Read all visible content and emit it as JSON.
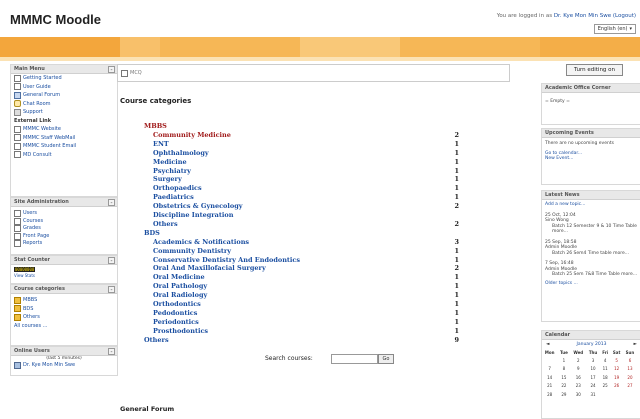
{
  "header": {
    "site_title": "MMMC Moodle",
    "login_prefix": "You are logged in as",
    "login_user": "Dr. Kye Mon Min Swe",
    "login_suffix": "(Logout)",
    "language": "English (en)"
  },
  "brand_colors": {
    "band": "#f6b756",
    "band_light": "#fbe2b4",
    "link": "#1a4ea0",
    "category_red": "#a01a1a"
  },
  "main_menu": {
    "title": "Main Menu",
    "items": [
      {
        "label": "Getting Started",
        "icon": "doc-icon"
      },
      {
        "label": "User Guide",
        "icon": "doc-icon"
      },
      {
        "label": "General Forum",
        "icon": "forum-icon"
      },
      {
        "label": "Chat Room",
        "icon": "chat-icon"
      },
      {
        "label": "Support",
        "icon": "lock-icon"
      }
    ],
    "external_title": "External Link",
    "external": [
      {
        "label": "MMMC Website"
      },
      {
        "label": "MMMC Staff WebMail"
      },
      {
        "label": "MMMC Student Email"
      },
      {
        "label": "MD Consult"
      }
    ]
  },
  "site_admin": {
    "title": "Site Administration",
    "items": [
      "Users",
      "Courses",
      "Grades",
      "Front Page",
      "Reports"
    ]
  },
  "stat_counter": {
    "title": "Stat Counter",
    "counter": "00000000",
    "caption": "View Stats"
  },
  "course_categories_block": {
    "title": "Course categories",
    "items": [
      "MBBS",
      "BDS",
      "Others"
    ],
    "all_courses": "All courses ..."
  },
  "online_users": {
    "title": "Online Users",
    "note": "(last 5 minutes)",
    "user": "Dr. Kye Mon Min Swe"
  },
  "main": {
    "mcq": "MCQ",
    "heading": "Course categories",
    "search_label": "Search courses:",
    "go_label": "Go",
    "general_forum": "General Forum"
  },
  "categories": [
    {
      "name": "MBBS",
      "count": "",
      "level": 0,
      "red": true
    },
    {
      "name": "Community Medicine",
      "count": "2",
      "level": 1,
      "red": true
    },
    {
      "name": "ENT",
      "count": "1",
      "level": 1
    },
    {
      "name": "Ophthalmology",
      "count": "1",
      "level": 1
    },
    {
      "name": "Medicine",
      "count": "1",
      "level": 1
    },
    {
      "name": "Psychiatry",
      "count": "1",
      "level": 1
    },
    {
      "name": "Surgery",
      "count": "1",
      "level": 1
    },
    {
      "name": "Orthopaedics",
      "count": "1",
      "level": 1
    },
    {
      "name": "Paediatrics",
      "count": "1",
      "level": 1
    },
    {
      "name": "Obstetrics & Gynecology",
      "count": "2",
      "level": 1
    },
    {
      "name": "Discipline Integration",
      "count": "",
      "level": 1
    },
    {
      "name": "Others",
      "count": "2",
      "level": 1
    },
    {
      "name": "BDS",
      "count": "",
      "level": 0
    },
    {
      "name": "Academics & Notifications",
      "count": "3",
      "level": 1
    },
    {
      "name": "Community Dentistry",
      "count": "1",
      "level": 1
    },
    {
      "name": "Conservative Dentistry And Endodontics",
      "count": "1",
      "level": 1
    },
    {
      "name": "Oral And Maxillofacial Surgery",
      "count": "2",
      "level": 1
    },
    {
      "name": "Oral Medicine",
      "count": "1",
      "level": 1
    },
    {
      "name": "Oral Pathology",
      "count": "1",
      "level": 1
    },
    {
      "name": "Oral Radiology",
      "count": "1",
      "level": 1
    },
    {
      "name": "Orthodontics",
      "count": "1",
      "level": 1
    },
    {
      "name": "Pedodontics",
      "count": "1",
      "level": 1
    },
    {
      "name": "Periodontics",
      "count": "1",
      "level": 1
    },
    {
      "name": "Prosthodontics",
      "count": "1",
      "level": 1
    },
    {
      "name": "Others",
      "count": "9",
      "level": 0
    }
  ],
  "right": {
    "turn_editing": "Turn editing on",
    "academic": {
      "title": "Academic Office Corner",
      "body": "= Empty ="
    },
    "upcoming": {
      "title": "Upcoming Events",
      "body": "There are no upcoming events",
      "link1": "Go to calendar...",
      "link2": "New Event..."
    },
    "news": {
      "title": "Latest News",
      "add": "Add a new topic...",
      "posts": [
        {
          "date": "25 Oct, 12:04",
          "author": "Sino Wong",
          "text": "Batch 12 Semester 9 & 10 Time Table more..."
        },
        {
          "date": "25 Sep, 18:58",
          "author": "Admin Moodle",
          "text": "Batch 26 Sem4 Time table more..."
        },
        {
          "date": "7 Sep, 16:48",
          "author": "Admin Moodle",
          "text": "Batch 25 Sem 7&8 Time Table more..."
        }
      ],
      "older": "Older topics ..."
    },
    "calendar": {
      "title": "Calendar",
      "month": "January 2013",
      "days": [
        "Mon",
        "Tue",
        "Wed",
        "Thu",
        "Fri",
        "Sat",
        "Sun"
      ],
      "weeks": [
        [
          "",
          "1",
          "2",
          "3",
          "4",
          "5",
          "6"
        ],
        [
          "7",
          "8",
          "9",
          "10",
          "11",
          "12",
          "13"
        ],
        [
          "14",
          "15",
          "16",
          "17",
          "18",
          "19",
          "20"
        ],
        [
          "21",
          "22",
          "23",
          "24",
          "25",
          "26",
          "27"
        ],
        [
          "28",
          "29",
          "30",
          "31",
          "",
          "",
          ""
        ]
      ]
    }
  }
}
